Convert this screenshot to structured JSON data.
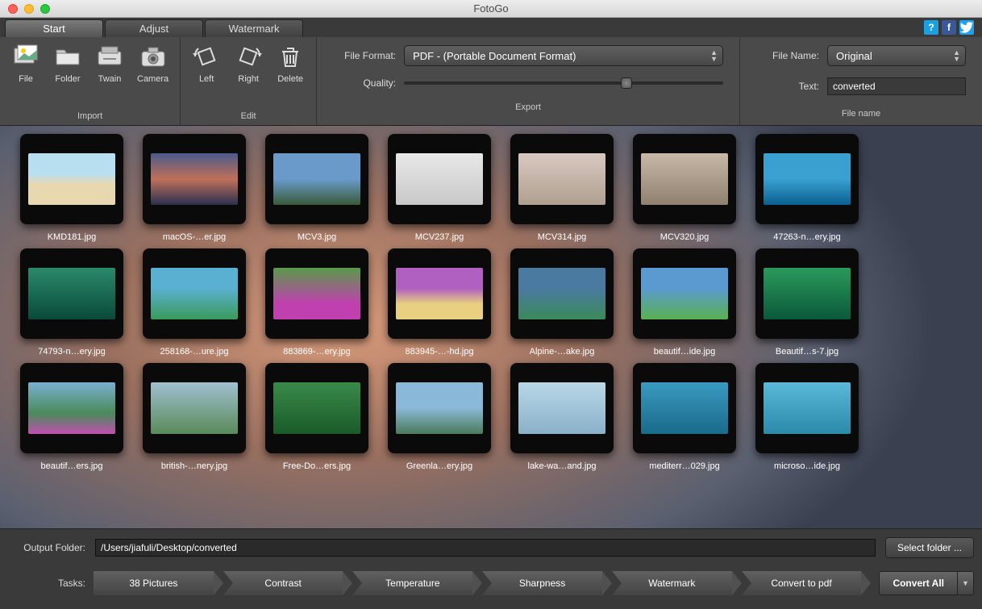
{
  "title": "FotoGo",
  "tabs": [
    "Start",
    "Adjust",
    "Watermark"
  ],
  "active_tab": 0,
  "ribbon": {
    "import": {
      "label": "Import",
      "items": [
        "File",
        "Folder",
        "Twain",
        "Camera"
      ]
    },
    "edit": {
      "label": "Edit",
      "items": [
        "Left",
        "Right",
        "Delete"
      ]
    },
    "export": {
      "label": "Export",
      "file_format_label": "File Format:",
      "file_format_value": "PDF - (Portable Document Format)",
      "quality_label": "Quality:"
    },
    "filename": {
      "label": "File name",
      "file_name_label": "File Name:",
      "file_name_value": "Original",
      "text_label": "Text:",
      "text_value": "converted"
    }
  },
  "thumbs": [
    {
      "name": "KMD181.jpg",
      "bg": "bg0"
    },
    {
      "name": "macOS-…er.jpg",
      "bg": "bg1"
    },
    {
      "name": "MCV3.jpg",
      "bg": "bg2"
    },
    {
      "name": "MCV237.jpg",
      "bg": "bg3"
    },
    {
      "name": "MCV314.jpg",
      "bg": "bg4"
    },
    {
      "name": "MCV320.jpg",
      "bg": "bg5"
    },
    {
      "name": "47263-n…ery.jpg",
      "bg": "bg6"
    },
    {
      "name": "74793-n…ery.jpg",
      "bg": "bg7"
    },
    {
      "name": "258168-…ure.jpg",
      "bg": "bg8"
    },
    {
      "name": "883869-…ery.jpg",
      "bg": "bg9"
    },
    {
      "name": "883945-…-hd.jpg",
      "bg": "bg10"
    },
    {
      "name": "Alpine-…ake.jpg",
      "bg": "bg11"
    },
    {
      "name": "beautif…ide.jpg",
      "bg": "bg12"
    },
    {
      "name": "Beautif…s-7.jpg",
      "bg": "bg13"
    },
    {
      "name": "beautif…ers.jpg",
      "bg": "bg14"
    },
    {
      "name": "british-…nery.jpg",
      "bg": "bg15"
    },
    {
      "name": "Free-Do…ers.jpg",
      "bg": "bg16"
    },
    {
      "name": "Greenla…ery.jpg",
      "bg": "bg17"
    },
    {
      "name": "lake-wa…and.jpg",
      "bg": "bg18"
    },
    {
      "name": "mediterr…029.jpg",
      "bg": "bg19"
    },
    {
      "name": "microso…ide.jpg",
      "bg": "bg20"
    }
  ],
  "bottom": {
    "output_folder_label": "Output Folder:",
    "output_folder_value": "/Users/jiafuli/Desktop/converted",
    "select_folder": "Select folder ...",
    "tasks_label": "Tasks:",
    "tasks": [
      "38 Pictures",
      "Contrast",
      "Temperature",
      "Sharpness",
      "Watermark",
      "Convert to pdf"
    ],
    "convert_all": "Convert All"
  }
}
